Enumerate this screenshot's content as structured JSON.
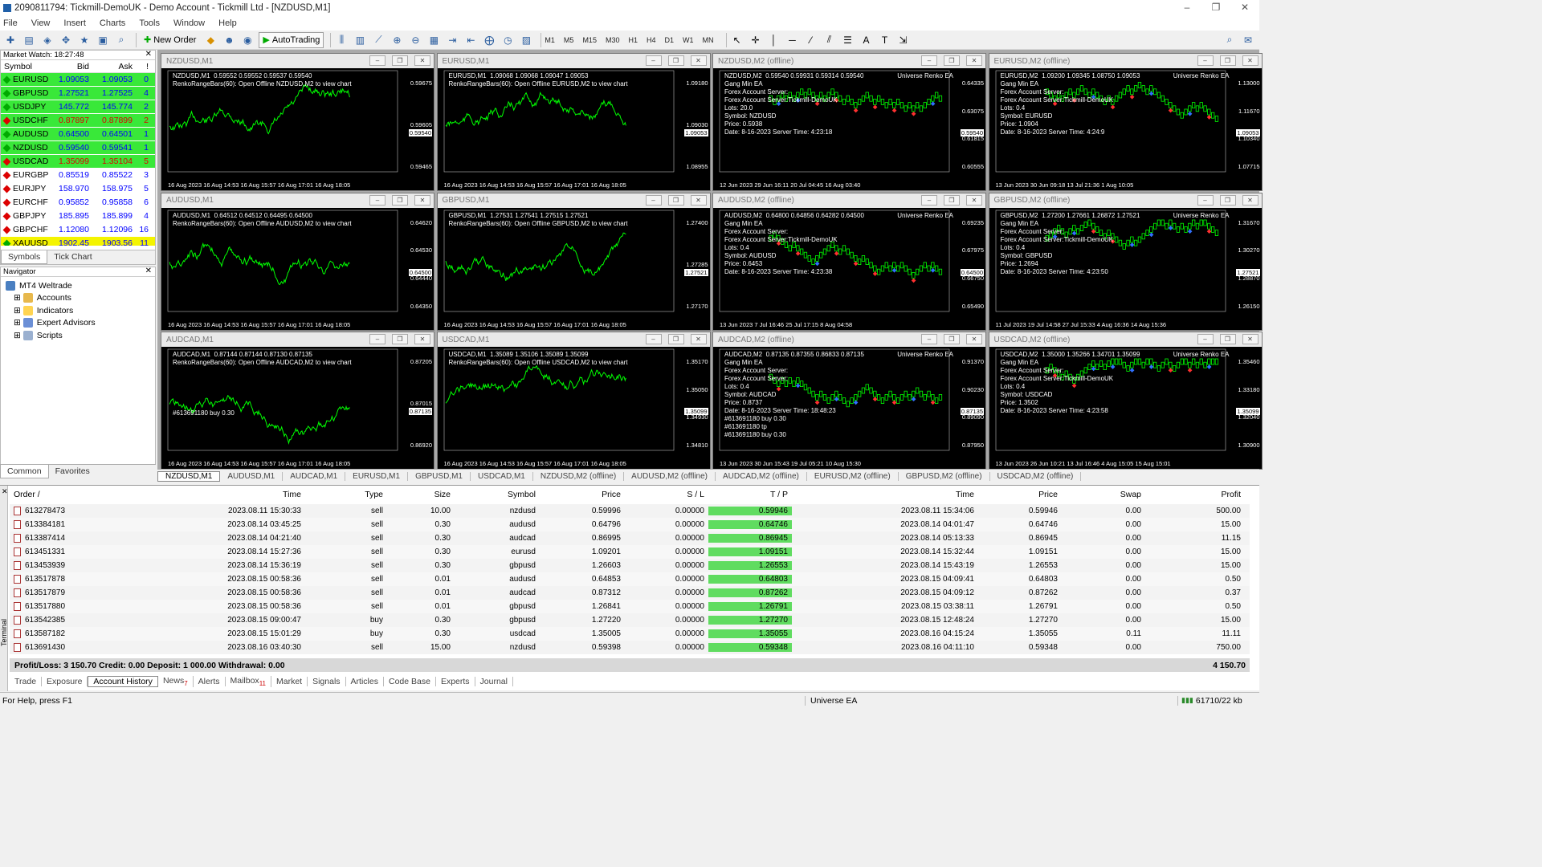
{
  "window": {
    "title": "2090811794: Tickmill-DemoUK - Demo Account - Tickmill Ltd - [NZDUSD,M1]"
  },
  "menu": [
    "File",
    "View",
    "Insert",
    "Charts",
    "Tools",
    "Window",
    "Help"
  ],
  "toolbar": {
    "new_order": "New Order",
    "autotrading": "AutoTrading",
    "timeframes": [
      "M1",
      "M5",
      "M15",
      "M30",
      "H1",
      "H4",
      "D1",
      "W1",
      "MN"
    ]
  },
  "market_watch": {
    "title": "Market Watch: 18:27:48",
    "cols": [
      "Symbol",
      "Bid",
      "Ask",
      "!"
    ],
    "rows": [
      {
        "s": "EURUSD",
        "b": "1.09053",
        "a": "1.09053",
        "sp": "0",
        "c": "#00d800"
      },
      {
        "s": "GBPUSD",
        "b": "1.27521",
        "a": "1.27525",
        "sp": "4",
        "c": "#00d800"
      },
      {
        "s": "USDJPY",
        "b": "145.772",
        "a": "145.774",
        "sp": "2",
        "c": "#00d800"
      },
      {
        "s": "USDCHF",
        "b": "0.87897",
        "a": "0.87899",
        "sp": "2",
        "c": "#e00000"
      },
      {
        "s": "AUDUSD",
        "b": "0.64500",
        "a": "0.64501",
        "sp": "1",
        "c": "#00d800"
      },
      {
        "s": "NZDUSD",
        "b": "0.59540",
        "a": "0.59541",
        "sp": "1",
        "c": "#00d800"
      },
      {
        "s": "USDCAD",
        "b": "1.35099",
        "a": "1.35104",
        "sp": "5",
        "c": "#e00000"
      },
      {
        "s": "EURGBP",
        "b": "0.85519",
        "a": "0.85522",
        "sp": "3",
        "c": "#ffffff"
      },
      {
        "s": "EURJPY",
        "b": "158.970",
        "a": "158.975",
        "sp": "5",
        "c": "#ffffff"
      },
      {
        "s": "EURCHF",
        "b": "0.95852",
        "a": "0.95858",
        "sp": "6",
        "c": "#ffffff"
      },
      {
        "s": "GBPJPY",
        "b": "185.895",
        "a": "185.899",
        "sp": "4",
        "c": "#ffffff"
      },
      {
        "s": "GBPCHF",
        "b": "1.12080",
        "a": "1.12096",
        "sp": "16",
        "c": "#ffffff"
      },
      {
        "s": "XAUUSD",
        "b": "1902.45",
        "a": "1903.56",
        "sp": "11",
        "c": "#f0f000"
      }
    ],
    "tabs": [
      "Symbols",
      "Tick Chart"
    ]
  },
  "navigator": {
    "title": "Navigator",
    "items": [
      "MT4 Weltrade",
      "Accounts",
      "Indicators",
      "Expert Advisors",
      "Scripts"
    ],
    "tabs": [
      "Common",
      "Favorites"
    ]
  },
  "charts": [
    {
      "t": "NZDUSD,M1",
      "info": "NZDUSD,M1  0.59552 0.59552 0.59537 0.59540\nRenkoRangeBars(60): Open Offline NZDUSD,M2 to view chart",
      "p": [
        "0.59675",
        "0.59605",
        "0.59465"
      ],
      "box": "0.59540",
      "x": "16 Aug 2023   16 Aug 14:53   16 Aug 15:57   16 Aug 17:01   16 Aug 18:05",
      "kind": "line"
    },
    {
      "t": "EURUSD,M1",
      "info": "EURUSD,M1  1.09068 1.09068 1.09047 1.09053\nRenkoRangeBars(60): Open Offline EURUSD,M2 to view chart",
      "p": [
        "1.09180",
        "1.09030",
        "1.08955"
      ],
      "box": "1.09053",
      "x": "16 Aug 2023   16 Aug 14:53   16 Aug 15:57   16 Aug 17:01   16 Aug 18:05",
      "kind": "line"
    },
    {
      "t": "NZDUSD,M2 (offline)",
      "info": "NZDUSD,M2  0.59540 0.59931 0.59314 0.59540\nGang Min EA\nForex Account Server:\nForex Account Server:Tickmill-DemoUK\nLots: 20.0\nSymbol: NZDUSD\nPrice: 0.5938\nDate: 8-16-2023 Server Time: 4:23:18",
      "p": [
        "0.64335",
        "0.63075",
        "0.61815",
        "0.60555"
      ],
      "box": "0.59540",
      "x": "12 Jun 2023   29 Jun 16:11   20 Jul 04:45   16 Aug 03:40",
      "kind": "renko",
      "ea": "Universe Renko EA"
    },
    {
      "t": "EURUSD,M2 (offline)",
      "info": "EURUSD,M2  1.09200 1.09345 1.08750 1.09053\nGang Min EA\nForex Account Server:\nForex Account Server:Tickmill-DemoUK\nLots: 0.4\nSymbol: EURUSD\nPrice: 1.0904\nDate: 8-16-2023 Server Time: 4:24:9",
      "p": [
        "1.13000",
        "1.11670",
        "1.10340",
        "1.07715"
      ],
      "box": "1.09053",
      "x": "13 Jun 2023   30 Jun 09:18   13 Jul 21:36   1 Aug 10:05",
      "kind": "renko",
      "ea": "Universe Renko EA"
    },
    {
      "t": "AUDUSD,M1",
      "info": "AUDUSD,M1  0.64512 0.64512 0.64495 0.64500\nRenkoRangeBars(60): Open Offline AUDUSD,M2 to view chart",
      "p": [
        "0.64620",
        "0.64530",
        "0.64440",
        "0.64350"
      ],
      "box": "0.64500",
      "x": "16 Aug 2023   16 Aug 14:53   16 Aug 15:57   16 Aug 17:01   16 Aug 18:05",
      "kind": "line"
    },
    {
      "t": "GBPUSD,M1",
      "info": "GBPUSD,M1  1.27531 1.27541 1.27515 1.27521\nRenkoRangeBars(60): Open Offline GBPUSD,M2 to view chart",
      "p": [
        "1.27400",
        "1.27285",
        "1.27170"
      ],
      "box": "1.27521",
      "x": "16 Aug 2023   16 Aug 14:53   16 Aug 15:57   16 Aug 17:01   16 Aug 18:05",
      "kind": "line"
    },
    {
      "t": "AUDUSD,M2 (offline)",
      "info": "AUDUSD,M2  0.64800 0.64856 0.64282 0.64500\nGang Min EA\nForex Account Server:\nForex Account Server:Tickmill-DemoUK\nLots: 0.4\nSymbol: AUDUSD\nPrice: 0.6453\nDate: 8-16-2023 Server Time: 4:23:38",
      "p": [
        "0.69235",
        "0.67975",
        "0.66750",
        "0.65490"
      ],
      "box": "0.64500",
      "x": "13 Jun 2023   7 Jul 16:46   25 Jul 17:15   8 Aug 04:58",
      "kind": "renko",
      "ea": "Universe Renko EA"
    },
    {
      "t": "GBPUSD,M2 (offline)",
      "info": "GBPUSD,M2  1.27200 1.27661 1.26872 1.27521\nGang Min EA\nForex Account Server:\nForex Account Server:Tickmill-DemoUK\nLots: 0.4\nSymbol: GBPUSD\nPrice: 1.2694\nDate: 8-16-2023 Server Time: 4:23:50",
      "p": [
        "1.31670",
        "1.30270",
        "1.28870",
        "1.26150"
      ],
      "box": "1.27521",
      "x": "11 Jul 2023   19 Jul 14:58   27 Jul 15:33   4 Aug 16:36   14 Aug 15:36",
      "kind": "renko",
      "ea": "Universe Renko EA"
    },
    {
      "t": "AUDCAD,M1",
      "info": "AUDCAD,M1  0.87144 0.87144 0.87130 0.87135\nRenkoRangeBars(60): Open Offline AUDCAD,M2 to view chart",
      "p": [
        "0.87205",
        "0.87015",
        "0.86920"
      ],
      "box": "0.87135",
      "x": "16 Aug 2023   16 Aug 14:53   16 Aug 15:57   16 Aug 17:01   16 Aug 18:05",
      "kind": "line",
      "order": "#613691180 buy 0.30"
    },
    {
      "t": "USDCAD,M1",
      "info": "USDCAD,M1  1.35089 1.35106 1.35089 1.35099\nRenkoRangeBars(60): Open Offline USDCAD,M2 to view chart",
      "p": [
        "1.35170",
        "1.35050",
        "1.34930",
        "1.34810"
      ],
      "box": "1.35099",
      "x": "16 Aug 2023   16 Aug 14:53   16 Aug 15:57   16 Aug 17:01   16 Aug 18:05",
      "kind": "line"
    },
    {
      "t": "AUDCAD,M2 (offline)",
      "info": "AUDCAD,M2  0.87135 0.87355 0.86833 0.87135\nGang Min EA\nForex Account Server:\nForex Account Server:\nLots: 0.4\nSymbol: AUDCAD\nPrice: 0.8737\nDate: 8-16-2023 Server Time: 18:48:23\n#613691180 buy 0.30\n#613691180 tp\n#613691180 buy 0.30",
      "p": [
        "0.91370",
        "0.90230",
        "0.89090",
        "0.87950"
      ],
      "box": "0.87135",
      "x": "13 Jun 2023   30 Jun 15:43   19 Jul 05:21   10 Aug 15:30",
      "kind": "renko",
      "ea": "Universe Renko EA"
    },
    {
      "t": "USDCAD,M2 (offline)",
      "info": "USDCAD,M2  1.35000 1.35266 1.34701 1.35099\nGang Min EA\nForex Account Server:\nForex Account Server:Tickmill-DemoUK\nLots: 0.4\nSymbol: USDCAD\nPrice: 1.3502\nDate: 8-16-2023 Server Time: 4:23:58",
      "p": [
        "1.35460",
        "1.33180",
        "1.32040",
        "1.30900"
      ],
      "box": "1.35099",
      "x": "13 Jun 2023   26 Jun 10:21   13 Jul 16:46   4 Aug 15:05   15 Aug 15:01",
      "kind": "renko",
      "ea": "Universe Renko EA"
    }
  ],
  "chart_tabs": [
    "NZDUSD,M1",
    "AUDUSD,M1",
    "AUDCAD,M1",
    "EURUSD,M1",
    "GBPUSD,M1",
    "USDCAD,M1",
    "NZDUSD,M2 (offline)",
    "AUDUSD,M2 (offline)",
    "AUDCAD,M2 (offline)",
    "EURUSD,M2 (offline)",
    "GBPUSD,M2 (offline)",
    "USDCAD,M2 (offline)"
  ],
  "history": {
    "cols": [
      "Order",
      "Time",
      "Type",
      "Size",
      "Symbol",
      "Price",
      "S / L",
      "T / P",
      "Time",
      "Price",
      "Swap",
      "Profit"
    ],
    "rows": [
      [
        "613278473",
        "2023.08.11 15:30:33",
        "sell",
        "10.00",
        "nzdusd",
        "0.59996",
        "0.00000",
        "0.59946",
        "2023.08.11 15:34:06",
        "0.59946",
        "0.00",
        "500.00"
      ],
      [
        "613384181",
        "2023.08.14 03:45:25",
        "sell",
        "0.30",
        "audusd",
        "0.64796",
        "0.00000",
        "0.64746",
        "2023.08.14 04:01:47",
        "0.64746",
        "0.00",
        "15.00"
      ],
      [
        "613387414",
        "2023.08.14 04:21:40",
        "sell",
        "0.30",
        "audcad",
        "0.86995",
        "0.00000",
        "0.86945",
        "2023.08.14 05:13:33",
        "0.86945",
        "0.00",
        "11.15"
      ],
      [
        "613451331",
        "2023.08.14 15:27:36",
        "sell",
        "0.30",
        "eurusd",
        "1.09201",
        "0.00000",
        "1.09151",
        "2023.08.14 15:32:44",
        "1.09151",
        "0.00",
        "15.00"
      ],
      [
        "613453939",
        "2023.08.14 15:36:19",
        "sell",
        "0.30",
        "gbpusd",
        "1.26603",
        "0.00000",
        "1.26553",
        "2023.08.14 15:43:19",
        "1.26553",
        "0.00",
        "15.00"
      ],
      [
        "613517878",
        "2023.08.15 00:58:36",
        "sell",
        "0.01",
        "audusd",
        "0.64853",
        "0.00000",
        "0.64803",
        "2023.08.15 04:09:41",
        "0.64803",
        "0.00",
        "0.50"
      ],
      [
        "613517879",
        "2023.08.15 00:58:36",
        "sell",
        "0.01",
        "audcad",
        "0.87312",
        "0.00000",
        "0.87262",
        "2023.08.15 04:09:12",
        "0.87262",
        "0.00",
        "0.37"
      ],
      [
        "613517880",
        "2023.08.15 00:58:36",
        "sell",
        "0.01",
        "gbpusd",
        "1.26841",
        "0.00000",
        "1.26791",
        "2023.08.15 03:38:11",
        "1.26791",
        "0.00",
        "0.50"
      ],
      [
        "613542385",
        "2023.08.15 09:00:47",
        "buy",
        "0.30",
        "gbpusd",
        "1.27220",
        "0.00000",
        "1.27270",
        "2023.08.15 12:48:24",
        "1.27270",
        "0.00",
        "15.00"
      ],
      [
        "613587182",
        "2023.08.15 15:01:29",
        "buy",
        "0.30",
        "usdcad",
        "1.35005",
        "0.00000",
        "1.35055",
        "2023.08.16 04:15:24",
        "1.35055",
        "0.11",
        "11.11"
      ],
      [
        "613691430",
        "2023.08.16 03:40:30",
        "sell",
        "15.00",
        "nzdusd",
        "0.59398",
        "0.00000",
        "0.59348",
        "2023.08.16 04:11:10",
        "0.59348",
        "0.00",
        "750.00"
      ]
    ],
    "summary": "Profit/Loss: 3 150.70  Credit: 0.00  Deposit: 1 000.00  Withdrawal: 0.00",
    "total": "4 150.70"
  },
  "terminal_tabs": [
    "Trade",
    "Exposure",
    "Account History",
    "News",
    "Alerts",
    "Mailbox",
    "Market",
    "Signals",
    "Articles",
    "Code Base",
    "Experts",
    "Journal"
  ],
  "terminal_badges": {
    "News": "7",
    "Mailbox": "11"
  },
  "terminal_label": "Terminal",
  "status": {
    "help": "For Help, press F1",
    "ea": "Universe EA",
    "traffic": "61710/22 kb"
  }
}
